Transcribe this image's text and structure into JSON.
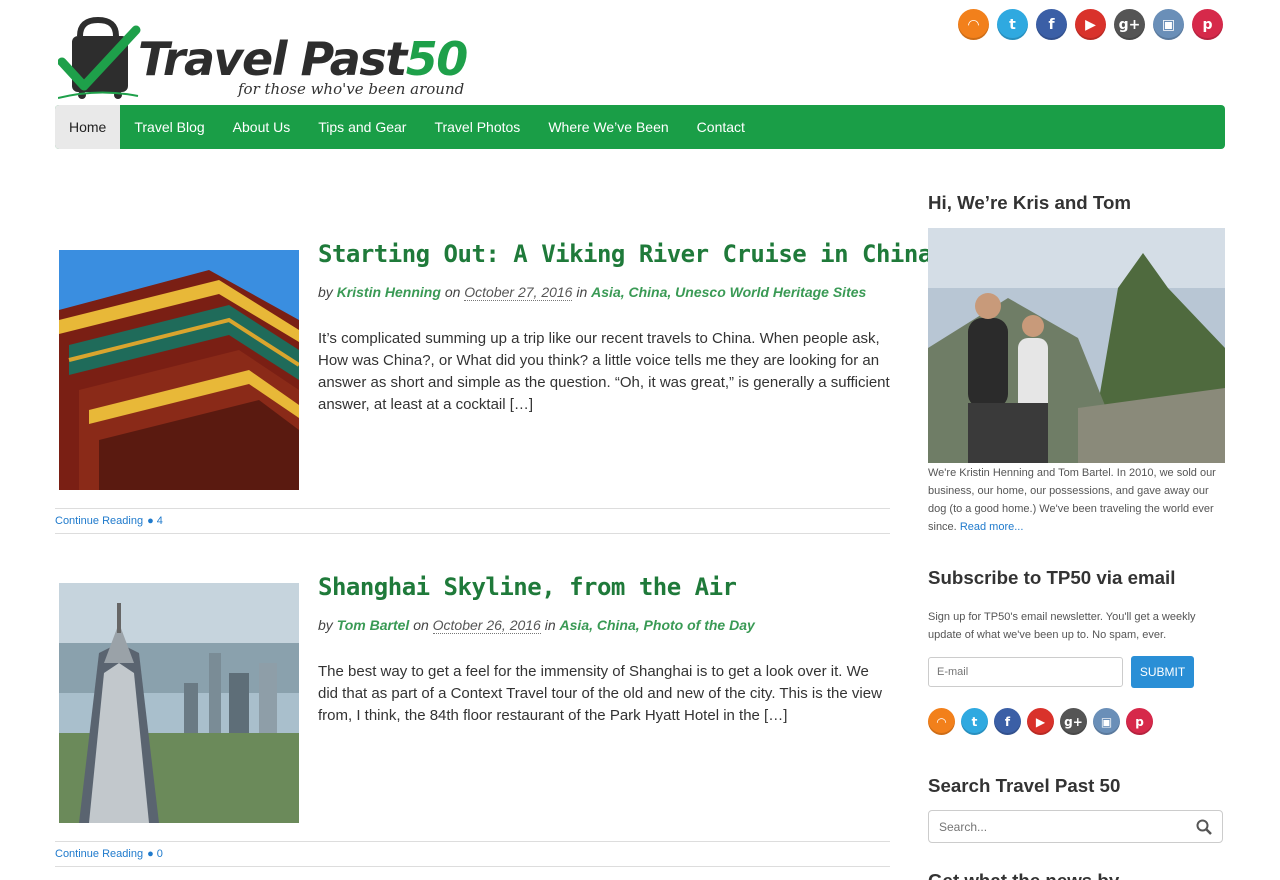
{
  "site": {
    "name_part1": "Travel Past",
    "name_part2": "50",
    "tagline": "for those who've been around",
    "brand_color": "#1a9e47"
  },
  "social": [
    {
      "name": "rss-icon",
      "glyph": "◠",
      "color": "#f2801b"
    },
    {
      "name": "twitter-icon",
      "glyph": "t",
      "color": "#2fa9e0"
    },
    {
      "name": "facebook-icon",
      "glyph": "f",
      "color": "#3b5fa6"
    },
    {
      "name": "youtube-icon",
      "glyph": "▶",
      "color": "#d9322b"
    },
    {
      "name": "googleplus-icon",
      "glyph": "g+",
      "color": "#555555"
    },
    {
      "name": "instagram-icon",
      "glyph": "▣",
      "color": "#6a8fb8"
    },
    {
      "name": "pinterest-icon",
      "glyph": "p",
      "color": "#d6294a"
    }
  ],
  "nav": [
    "Home",
    "Travel Blog",
    "About Us",
    "Tips and Gear",
    "Travel Photos",
    "Where We’ve Been",
    "Contact"
  ],
  "posts": [
    {
      "title": "Starting Out: A Viking River Cruise in China",
      "by": "by",
      "author": "Kristin Henning",
      "on": "on",
      "date": "October 27, 2016",
      "in": "in",
      "categories": "Asia, China, Unesco World Heritage Sites",
      "excerpt": "It’s complicated summing up a trip like our recent travels to China. When people ask, How was China?, or What did you think? a little voice tells me they are looking for an answer as short and simple as the question. “Oh, it was great,” is generally a sufficient answer, at least at a cocktail […]",
      "continue": "Continue Reading",
      "comments": "4"
    },
    {
      "title": "Shanghai Skyline, from the Air",
      "by": "by",
      "author": "Tom Bartel",
      "on": "on",
      "date": "October 26, 2016",
      "in": "in",
      "categories": "Asia, China, Photo of the Day",
      "excerpt": "The best way to get a feel for the immensity of Shanghai is to get a look over it. We did that as part of a Context Travel tour of the old and new of the city. This is the view from, I think, the 84th floor restaurant of the Park Hyatt Hotel in the […]",
      "continue": "Continue Reading",
      "comments": "0"
    }
  ],
  "sidebar": {
    "about_title": "Hi, We’re Kris and Tom",
    "about_text": "We're Kristin Henning and Tom Bartel. In 2010, we sold our business, our home, our possessions, and gave away our dog (to a good home.) We've been traveling the world ever since.",
    "read_more": "Read more...",
    "subscribe_title": "Subscribe to TP50 via email",
    "subscribe_text": "Sign up for TP50's email newsletter. You'll get a weekly update of what we've been up to. No spam, ever.",
    "email_placeholder": "E-mail",
    "submit_label": "SUBMIT",
    "search_title": "Search Travel Past 50",
    "search_placeholder": "Search...",
    "next_title": "Get what the news by..."
  }
}
